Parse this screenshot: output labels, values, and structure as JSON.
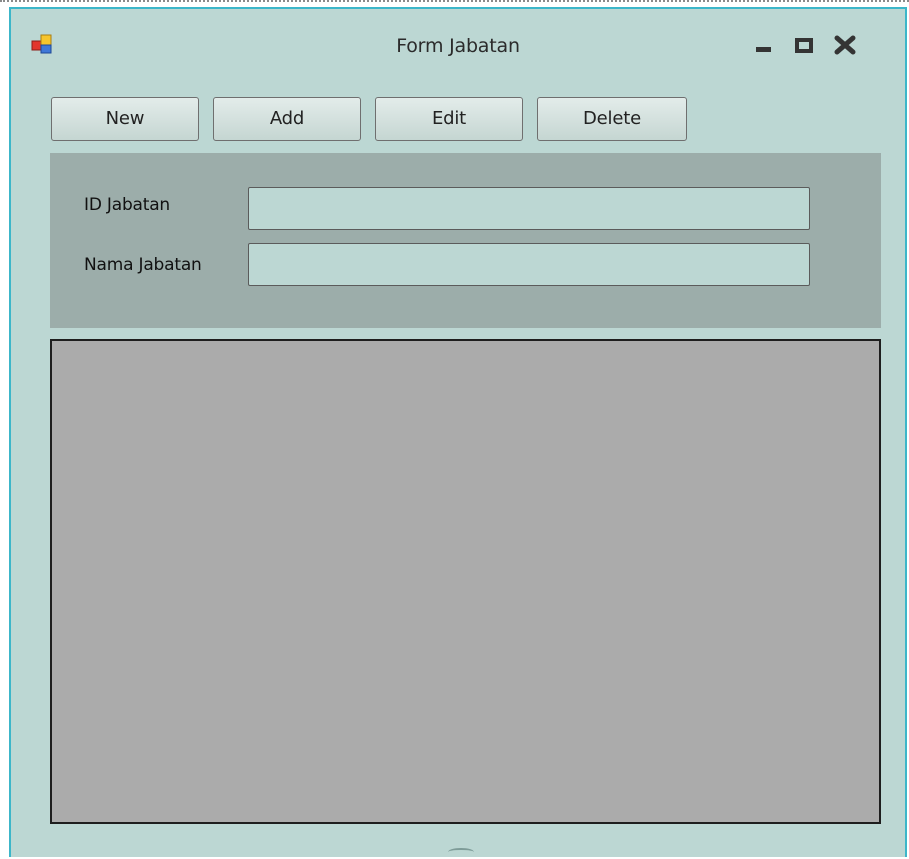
{
  "window": {
    "title": "Form Jabatan",
    "icon": "windows-form-icon",
    "controls": [
      "minimize-icon",
      "maximize-icon",
      "close-icon"
    ]
  },
  "toolbar": {
    "new_label": "New",
    "add_label": "Add",
    "edit_label": "Edit",
    "delete_label": "Delete"
  },
  "form": {
    "id_label": "ID Jabatan",
    "id_value": "",
    "nama_label": "Nama Jabatan",
    "nama_value": ""
  },
  "grid": {
    "rows": []
  },
  "colors": {
    "form_background": "#bcd7d3",
    "panel_background": "#9cadaa",
    "grid_background": "#ababab",
    "window_border": "#3cb6c9"
  }
}
